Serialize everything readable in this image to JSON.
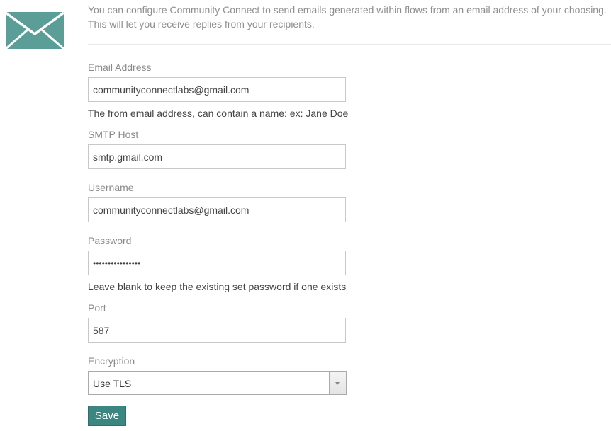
{
  "colors": {
    "brand_teal": "#5a9e97",
    "save_button": "#3b8681"
  },
  "intro": {
    "icon": "envelope-icon",
    "line1": "You can configure Community Connect to send emails generated within flows from an email address of your choosing.",
    "line2": "This will let you receive replies from your recipients."
  },
  "form": {
    "email": {
      "label": "Email Address",
      "value": "communityconnectlabs@gmail.com",
      "help": "The from email address, can contain a name: ex: Jane Doe"
    },
    "smtp_host": {
      "label": "SMTP Host",
      "value": "smtp.gmail.com"
    },
    "username": {
      "label": "Username",
      "value": "communityconnectlabs@gmail.com"
    },
    "password": {
      "label": "Password",
      "value": "••••••••••••••••",
      "help": "Leave blank to keep the existing set password if one exists"
    },
    "port": {
      "label": "Port",
      "value": "587"
    },
    "encryption": {
      "label": "Encryption",
      "selected": "Use TLS"
    },
    "save_label": "Save"
  }
}
